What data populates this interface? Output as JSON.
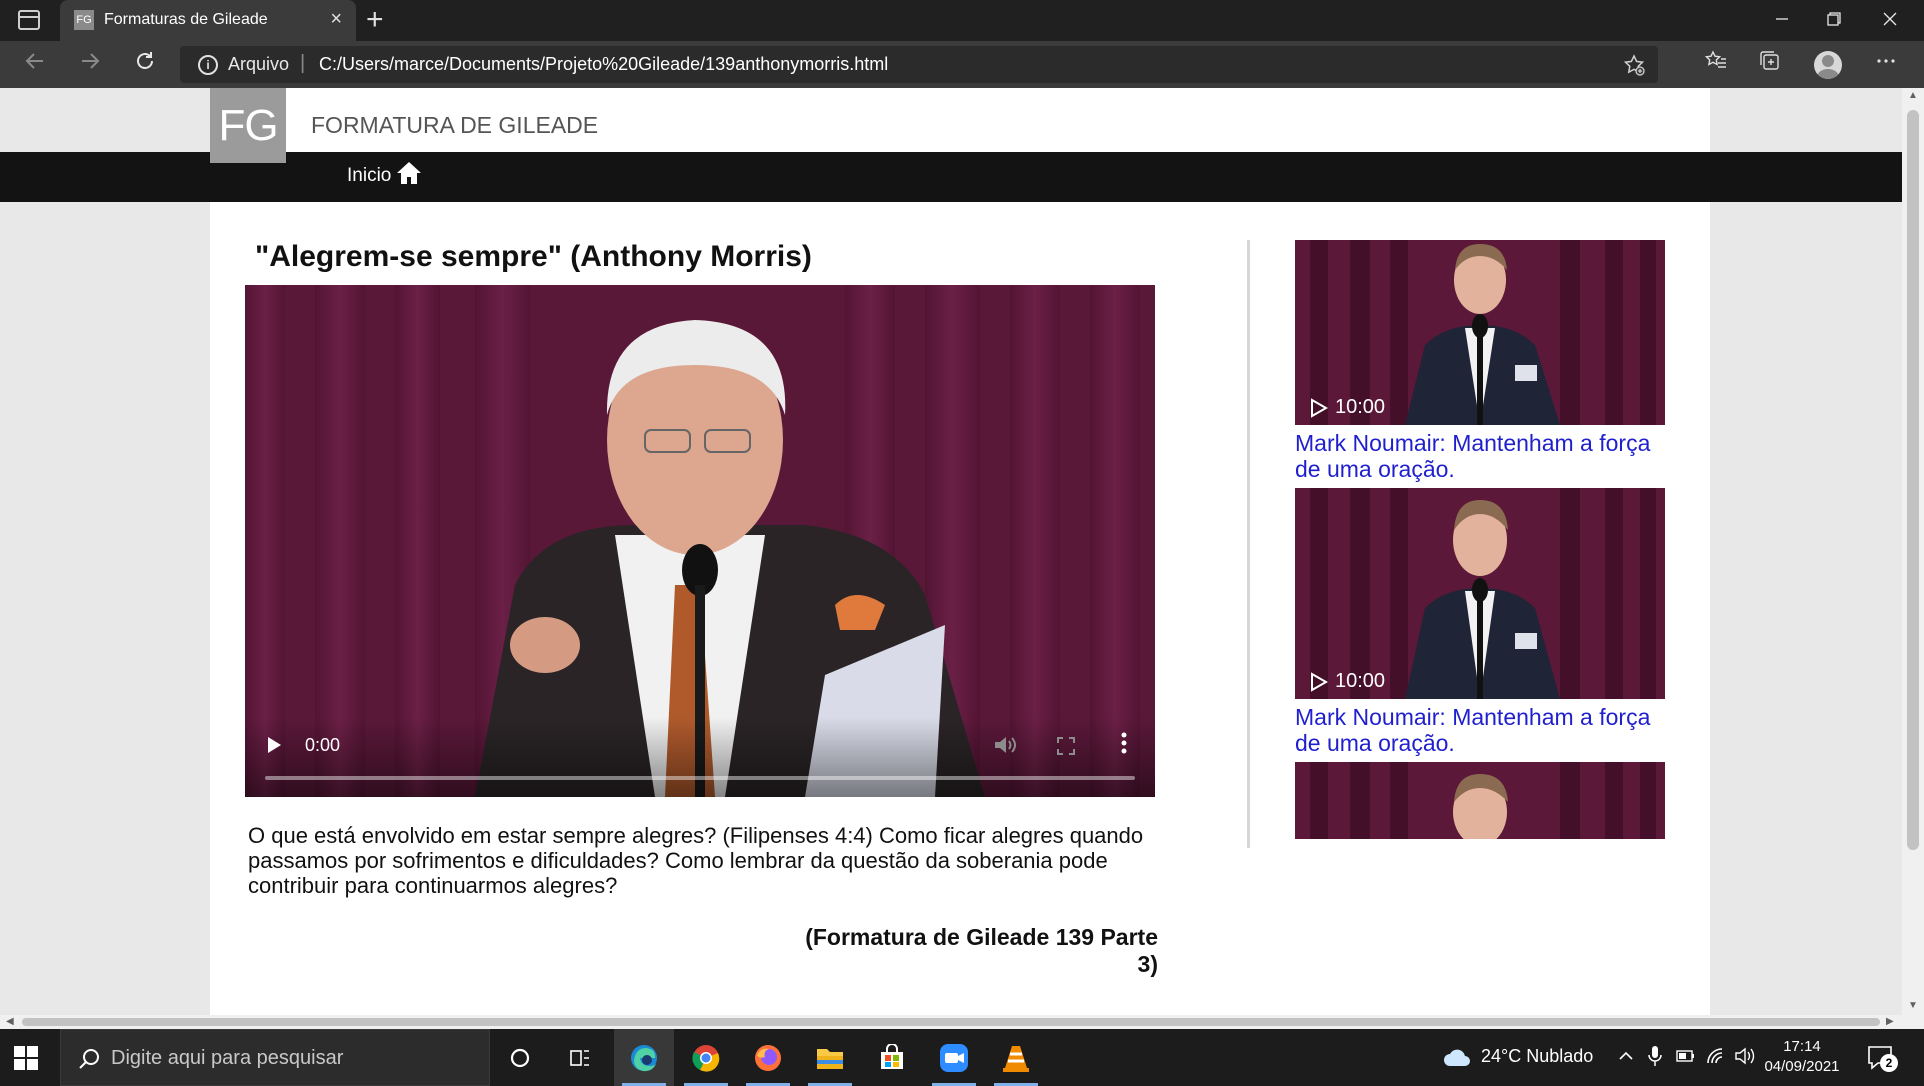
{
  "browser": {
    "tab_title": "Formaturas de Gileade",
    "tab_favicon_text": "FG",
    "tab_close": "×",
    "new_tab": "+",
    "address_scheme": "Arquivo",
    "address_separator": "|",
    "address_url": "C:/Users/marce/Documents/Projeto%20Gileade/139anthonymorris.html"
  },
  "site": {
    "logo": "FG",
    "title": "FORMATURA DE GILEADE",
    "nav_home": "Inicio"
  },
  "article": {
    "title": "\"Alegrem-se sempre\" (Anthony Morris)",
    "video_time": "0:00",
    "description": "O que está envolvido em estar sempre alegres? (Filipenses 4:4) Como ficar alegres quando passamos por sofrimentos e dificuldades? Como lembrar da questão da soberania pode contribuir para continuarmos alegres?",
    "source": "(Formatura de Gileade 139 Parte 3)"
  },
  "sidebar": {
    "items": [
      {
        "duration": "10:00",
        "link": "Mark Noumair: Mantenham a força de uma oração."
      },
      {
        "duration": "10:00",
        "link": "Mark Noumair: Mantenham a força de uma oração."
      },
      {
        "duration": "",
        "link": ""
      }
    ]
  },
  "taskbar": {
    "search_placeholder": "Digite aqui para pesquisar",
    "weather": "24°C  Nublado",
    "time": "17:14",
    "date": "04/09/2021",
    "notifications_count": "2"
  },
  "colors": {
    "curtain": "#6b1f46",
    "link": "#1f1fce",
    "navbar": "#131313"
  }
}
